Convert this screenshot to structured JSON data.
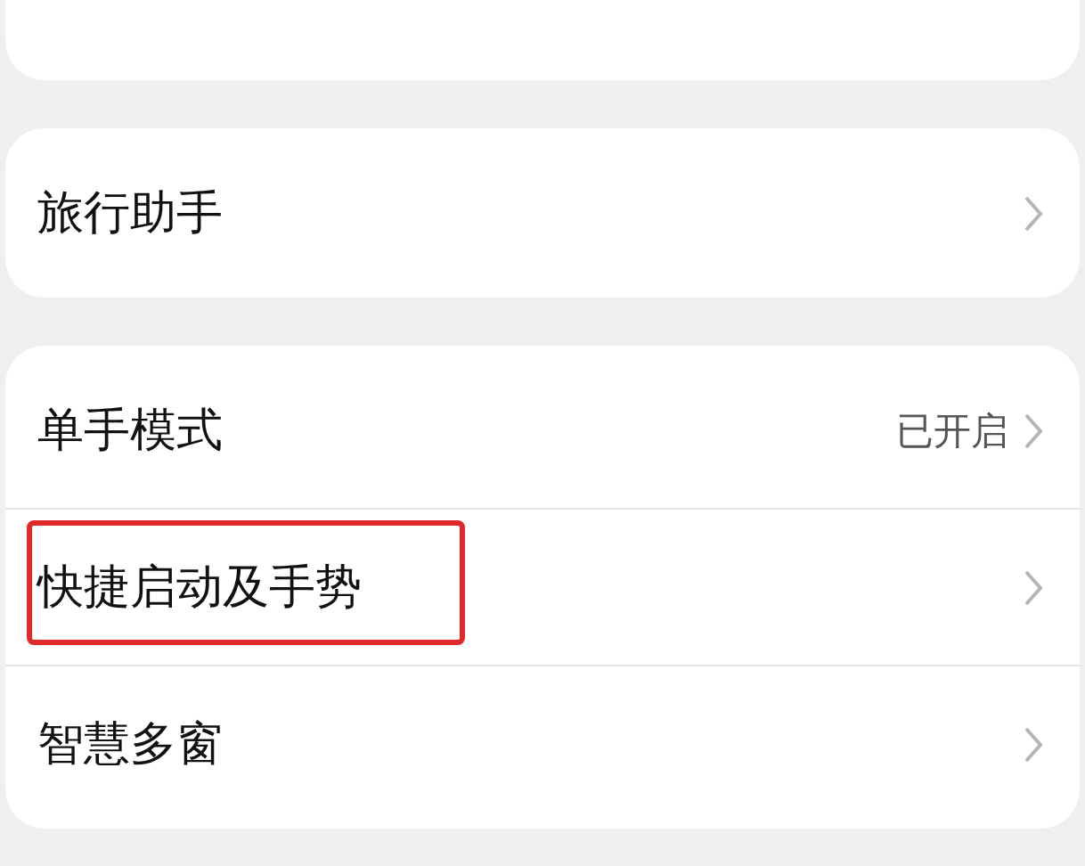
{
  "groups": [
    {
      "items": [
        {
          "label": "旅行助手",
          "highlighted": false
        }
      ]
    },
    {
      "items": [
        {
          "label": "单手模式",
          "value": "已开启",
          "highlighted": false
        },
        {
          "label": "快捷启动及手势",
          "highlighted": true
        },
        {
          "label": "智慧多窗",
          "highlighted": false
        }
      ]
    }
  ]
}
